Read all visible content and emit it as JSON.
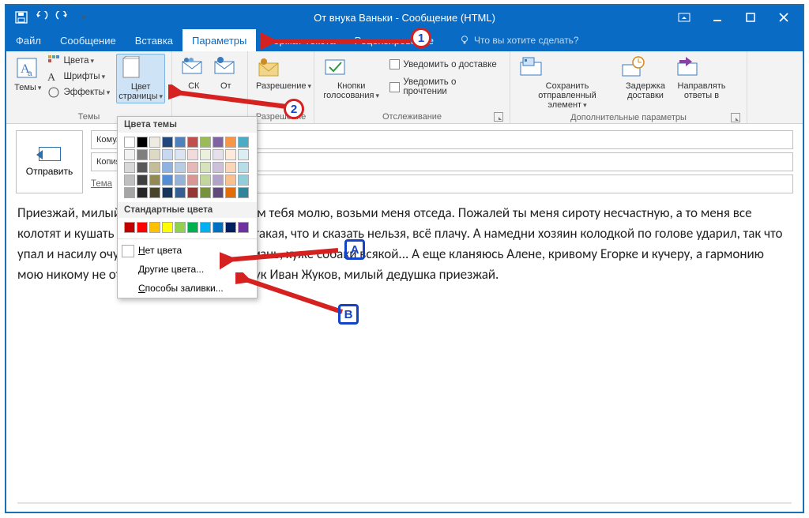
{
  "window": {
    "title": "От внука Ваньки - Сообщение (HTML)"
  },
  "tabs": {
    "file": "Файл",
    "message": "Сообщение",
    "insert": "Вставка",
    "options": "Параметры",
    "format": "Формат текста",
    "review": "Рецензирование",
    "tellme": "Что вы хотите сделать?"
  },
  "ribbon": {
    "themes": {
      "label": "Темы",
      "themes_btn": "Темы",
      "colors": "Цвета",
      "fonts": "Шрифты",
      "effects": "Эффекты",
      "page_color": "Цвет страницы"
    },
    "showfields": {
      "bcc": "СК",
      "from": "От"
    },
    "permission": {
      "btn": "Разрешение",
      "group": "Разрешение"
    },
    "tracking": {
      "voting": "Кнопки голосования",
      "delivery": "Уведомить о доставке",
      "read": "Уведомить о прочтении",
      "group": "Отслеживание"
    },
    "more": {
      "save_sent": "Сохранить отправленный элемент",
      "delay": "Задержка доставки",
      "direct": "Направлять ответы в",
      "group": "Дополнительные параметры"
    }
  },
  "dropdown": {
    "theme_colors": "Цвета темы",
    "standard_colors": "Стандартные цвета",
    "no_color": "Нет цвета",
    "more_colors": "Другие цвета...",
    "fill_effects": "Способы заливки..."
  },
  "compose": {
    "send": "Отправить",
    "to": "Кому...",
    "cc": "Копия...",
    "subject": "Тема"
  },
  "body": "Приезжай, милый дедушка, Христом богом тебя молю, возьми меня отседа. Пожалей ты меня сироту несчастную, а то меня все колотят и кушать страсть хочется, а скука такая, что и сказать нельзя, всё плачу. А намедни хозяин колодкой по голове ударил, так что упал и насилу очухался. Пропащая моя жизнь, хуже собаки всякой... А еще кланяюсь Алене, кривому Егорке и кучеру, а гармонию мою никому не отдавай. Остаюсь твой внук Иван Жуков, милый дедушка приезжай.",
  "badges": {
    "one": "1",
    "two": "2",
    "A": "A",
    "B": "B"
  }
}
